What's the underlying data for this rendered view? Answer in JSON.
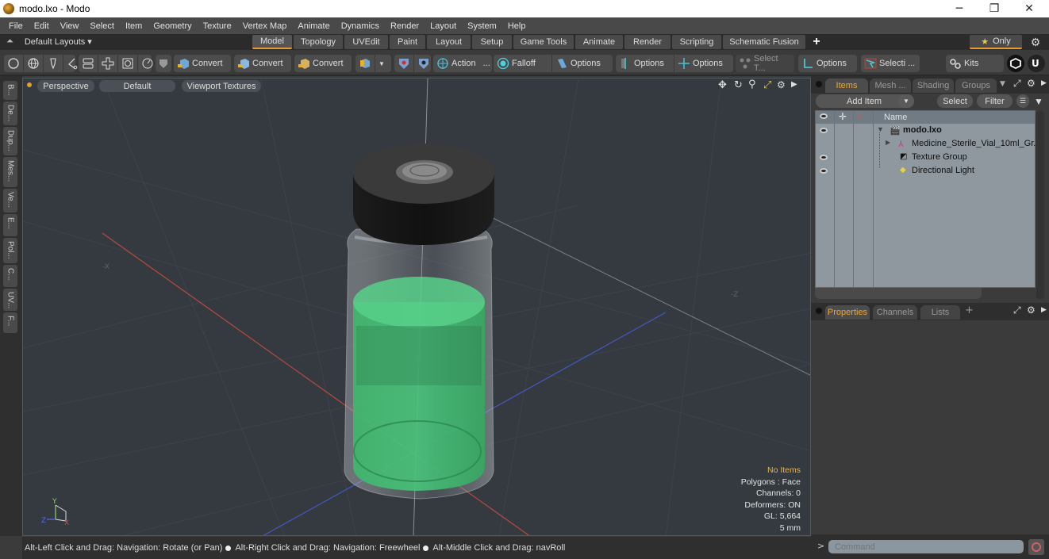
{
  "window": {
    "title": "modo.lxo - Modo",
    "controls": {
      "minimize": "─",
      "restore": "❐",
      "close": "✕"
    }
  },
  "menu": [
    "File",
    "Edit",
    "View",
    "Select",
    "Item",
    "Geometry",
    "Texture",
    "Vertex Map",
    "Animate",
    "Dynamics",
    "Render",
    "Layout",
    "System",
    "Help"
  ],
  "layout_bar": {
    "layouts_label": "Default Layouts ▾",
    "tabs": [
      "Model",
      "Topology",
      "UVEdit",
      "Paint",
      "Layout",
      "Setup",
      "Game Tools",
      "Animate",
      "Render",
      "Scripting",
      "Schematic Fusion"
    ],
    "active_tab": "Model",
    "add_tab": "+",
    "only_label": "Only",
    "star": "★"
  },
  "toolbar": {
    "convert1": "Convert",
    "convert2": "Convert",
    "convert3": "Convert",
    "action": "Action",
    "action_more": "...",
    "falloff": "Falloff",
    "options1": "Options",
    "options2": "Options",
    "options3": "Options",
    "select_t": "Select T...",
    "options4": "Options",
    "selecti": "Selecti ...",
    "kits": "Kits"
  },
  "left_tabs": [
    "B...",
    "De...",
    "Dup...",
    "Mes...",
    "Ve...",
    "E...",
    "Pol...",
    "C...",
    "UV...",
    "F..."
  ],
  "viewport": {
    "view_mode": "Perspective",
    "shading": "Default",
    "textures": "Viewport Textures",
    "stats": {
      "selection": "No Items",
      "polygons": "Polygons : Face",
      "channels": "Channels: 0",
      "deformers": "Deformers: ON",
      "gl": "GL: 5,664",
      "unit": "5 mm"
    },
    "colors": {
      "background": "#343a40",
      "liquid": "#45c47a",
      "cap": "#2a2a2a",
      "x_axis": "#c8524a",
      "z_axis": "#4a5ec8",
      "y_axis": "#8fd070"
    }
  },
  "status_bar": {
    "hint1": "Alt-Left Click and Drag: Navigation: Rotate (or Pan)",
    "hint2": "Alt-Right Click and Drag: Navigation: Freewheel",
    "hint3": "Alt-Middle Click and Drag: navRoll"
  },
  "items_panel": {
    "tabs": [
      "Items",
      "Mesh ...",
      "Shading",
      "Groups"
    ],
    "active_tab": "Items",
    "add_item": "Add Item",
    "select": "Select",
    "filter": "Filter",
    "column_name": "Name",
    "rows": [
      {
        "name": "modo.lxo",
        "visible": true,
        "bold": true
      },
      {
        "name": "Medicine_Sterile_Vial_10ml_Gr...",
        "visible": false,
        "bold": false
      },
      {
        "name": "Texture Group",
        "visible": true,
        "bold": false
      },
      {
        "name": "Directional Light",
        "visible": true,
        "bold": false
      }
    ]
  },
  "properties_panel": {
    "tabs": [
      "Properties",
      "Channels",
      "Lists"
    ],
    "active_tab": "Properties",
    "add_tab": "+"
  },
  "command": {
    "prompt": ">",
    "placeholder": "Command"
  },
  "accent_color": "#e69c32"
}
